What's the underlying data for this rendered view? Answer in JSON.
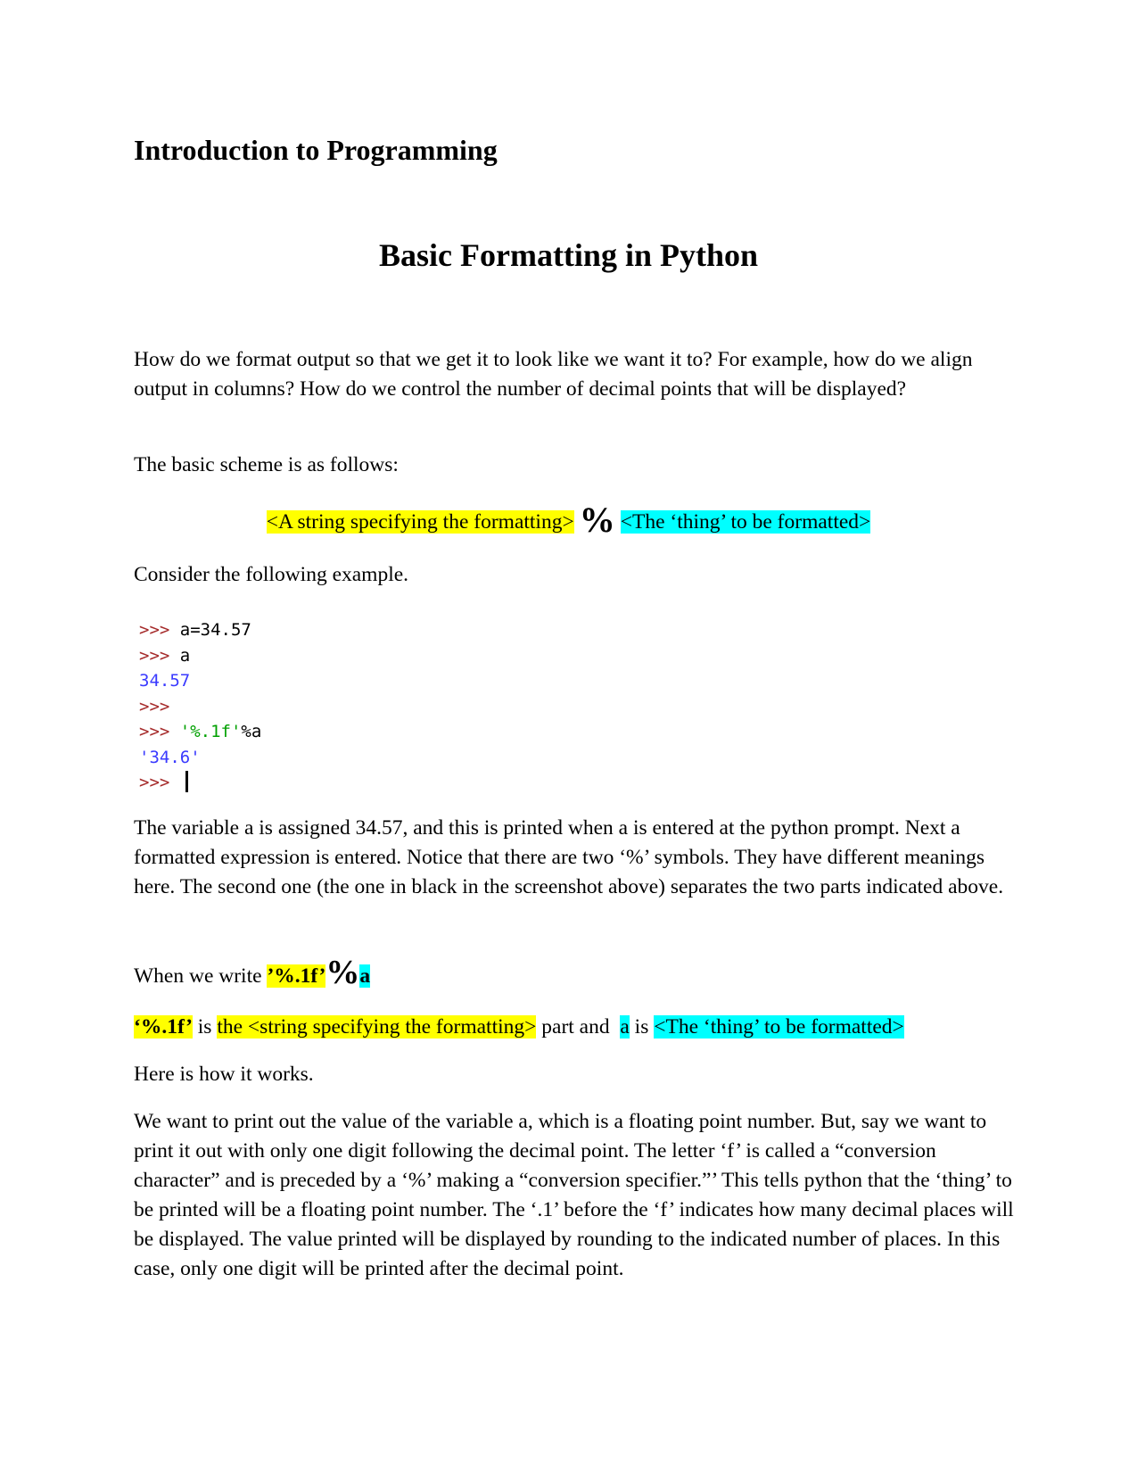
{
  "document": {
    "title": "Introduction to Programming",
    "heading": "Basic Formatting in Python",
    "intro_paragraph": "How do we format output so that we get it to look like we want it to? For example, how do we align output in columns? How do we control the number of decimal points that will be displayed?",
    "scheme_intro": "The basic scheme is as follows:",
    "scheme": {
      "format_string": "<A string specifying the formatting>",
      "operator": "%",
      "thing": "<The ‘thing’ to be formatted>"
    },
    "consider": "Consider the following example.",
    "code_lines": [
      {
        "prompt": ">>> ",
        "input": "a=34.57"
      },
      {
        "prompt": ">>> ",
        "input": "a"
      },
      {
        "output": "34.57"
      },
      {
        "prompt": ">>>"
      },
      {
        "prompt": ">>> ",
        "string": "'%.1f'",
        "input": "%a"
      },
      {
        "output": "'34.6'"
      },
      {
        "prompt": ">>> "
      }
    ],
    "explanation_paragraph": "The variable a is assigned 34.57, and this is printed when a is entered at the python prompt. Next a formatted expression is entered. Notice that there are two ‘%’ symbols. They have different meanings here. The second one (the one in black in the screenshot above) separates the two parts indicated above.",
    "when_we_write": {
      "prefix": "When we write ",
      "format_part": "’%.1f’",
      "operator": "%",
      "thing_part": "a"
    },
    "breakdown": {
      "format_part": "‘%.1f’",
      "is1": " is ",
      "format_desc": "the <string specifying the formatting>",
      "part_and": " part and  ",
      "thing_part": "a",
      "is2": " is ",
      "thing_desc": "<The ‘thing’ to be formatted>"
    },
    "how_it_works": "Here is how it works.",
    "final_paragraph": "We want to print out the value of the variable a, which is a floating point number. But, say we want to print it out with only one digit following the decimal point. The letter ‘f’ is called a “conversion character” and is preceded by a ‘%’ making a “conversion specifier.”’  This tells python that  the ‘thing’ to be printed will be a floating point number. The ‘.1’ before the ‘f’ indicates how many decimal places will be displayed. The value printed will be displayed by rounding to the indicated number of places. In this case, only one digit will be printed after the decimal point."
  },
  "colors": {
    "highlight_format": "#ffff00",
    "highlight_thing": "#00ffff",
    "prompt": "#a52a2a",
    "output": "#3a3aff",
    "string": "#00a000"
  }
}
